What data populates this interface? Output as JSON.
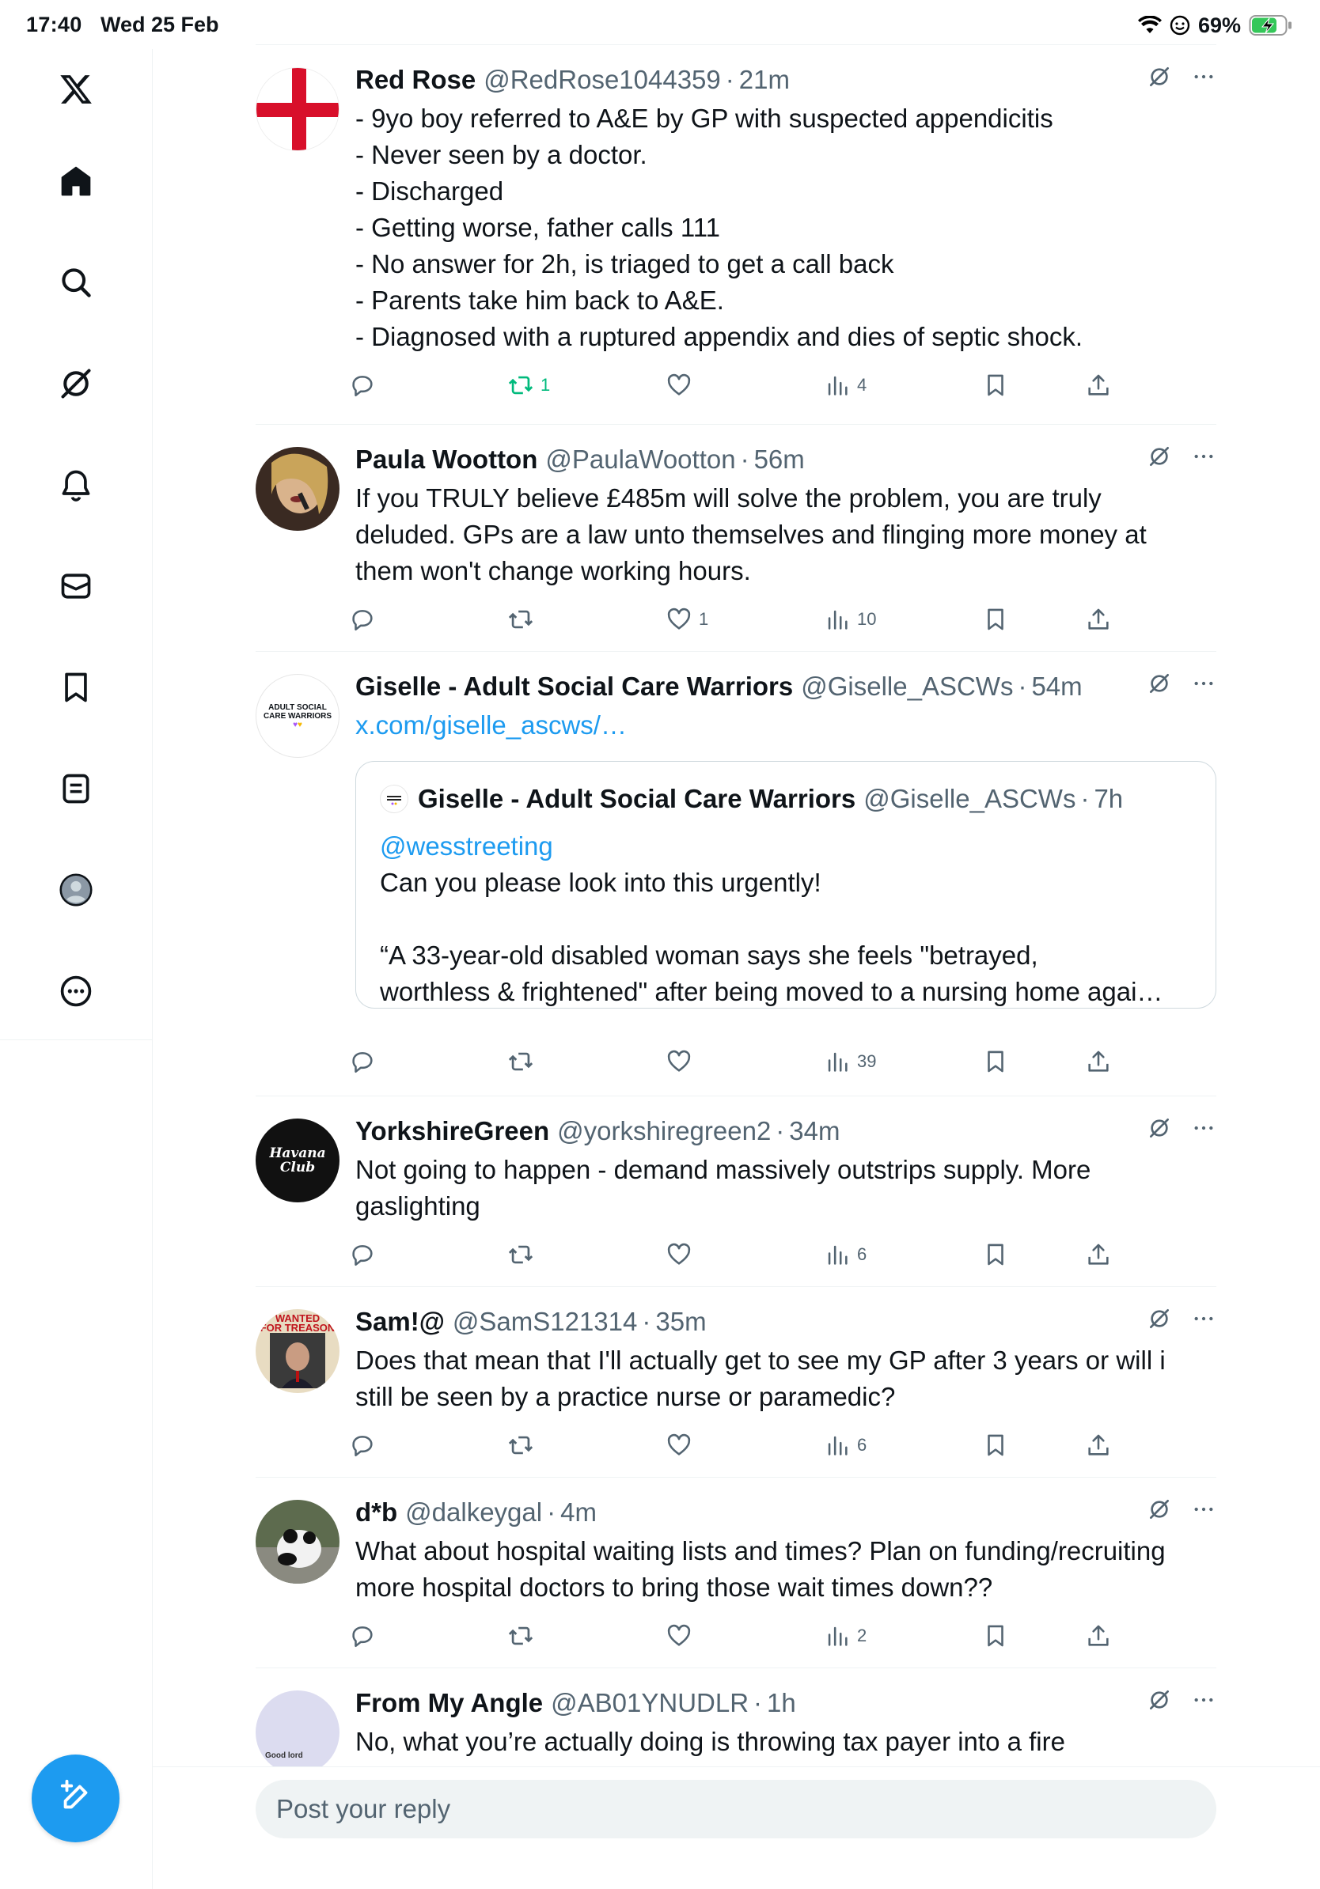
{
  "status_bar": {
    "time": "17:40",
    "date": "Wed 25 Feb",
    "battery": "69%",
    "icons": [
      "wifi-icon",
      "vpn-face-icon",
      "battery-charging-icon"
    ]
  },
  "sidebar": {
    "items": [
      {
        "name": "x-logo-icon"
      },
      {
        "name": "home-icon"
      },
      {
        "name": "search-icon"
      },
      {
        "name": "grok-icon"
      },
      {
        "name": "notifications-icon"
      },
      {
        "name": "messages-icon"
      },
      {
        "name": "bookmarks-icon"
      },
      {
        "name": "lists-icon"
      },
      {
        "name": "profile-icon"
      },
      {
        "name": "more-icon"
      }
    ],
    "compose_icon": "compose-icon"
  },
  "colors": {
    "accent": "#1d9bf0",
    "text": "#0f1419",
    "secondary": "#536471",
    "retweet_green": "#00ba7c",
    "divider": "#eff3f4"
  },
  "tweets": [
    {
      "name": "Red Rose",
      "handle": "@RedRose1044359",
      "dot": "·",
      "time": "21m",
      "text": "- 9yo boy referred to A&E by GP with suspected appendicitis\n- Never seen by a doctor.\n- Discharged\n- Getting worse, father calls 111\n- No answer for 2h, is triaged to get a call back\n- Parents take him back to A&E.\n- Diagnosed with a ruptured appendix and dies of septic shock.",
      "retweets": "1",
      "likes": "",
      "views": "4",
      "avatar": "st-george-cross"
    },
    {
      "name": "Paula Wootton",
      "handle": "@PaulaWootton",
      "dot": "·",
      "time": "56m",
      "text": "If you TRULY believe £485m will solve the problem, you are truly\ndeluded. GPs are a law unto themselves and flinging more money at\nthem won't change working hours.",
      "retweets": "",
      "likes": "1",
      "views": "10",
      "avatar": "photo"
    },
    {
      "name": "Giselle - Adult Social Care Warriors",
      "handle": "@Giselle_ASCWs",
      "dot": "·",
      "time": "54m",
      "link": "x.com/giselle_ascws/…",
      "avatar_text": "ADULT SOCIAL\nCARE WARRIORS",
      "quote": {
        "name": "Giselle - Adult Social Care Warriors",
        "handle": "@Giselle_ASCWs",
        "dot": "·",
        "time": "7h",
        "mention": "@wesstreeting",
        "text": "Can you please look into this urgently!\n\n“A 33-year-old disabled woman says she feels \"betrayed,\nworthless & frightened\" after being moved to a nursing home agai…"
      },
      "retweets": "",
      "likes": "",
      "views": "39"
    },
    {
      "name": "YorkshireGreen",
      "handle": "@yorkshiregreen2",
      "dot": "·",
      "time": "34m",
      "text": "Not going to happen - demand massively outstrips supply. More\ngaslighting",
      "retweets": "",
      "likes": "",
      "views": "6",
      "avatar_text": "Havana\nClub"
    },
    {
      "name": "Sam!@",
      "handle": "@SamS121314",
      "dot": "·",
      "time": "35m",
      "text": "Does that mean that I'll actually get to see my GP after 3 years or will i\nstill be seen by a practice nurse or paramedic?",
      "retweets": "",
      "likes": "",
      "views": "6",
      "avatar_text": "WANTED\nFOR TREASON"
    },
    {
      "name": "d*b",
      "handle": "@dalkeygal",
      "dot": "·",
      "time": "4m",
      "text": "What about hospital waiting lists and times? Plan on funding/recruiting\nmore hospital doctors to bring those wait times down??",
      "retweets": "",
      "likes": "",
      "views": "2",
      "avatar": "panda-photo"
    },
    {
      "name": "From My Angle",
      "handle": "@AB01YNUDLR",
      "dot": "·",
      "time": "1h",
      "text": "No, what you’re actually doing is throwing tax payer into a fire",
      "avatar_text": "Good lord"
    }
  ],
  "reply": {
    "placeholder": "Post your reply"
  }
}
